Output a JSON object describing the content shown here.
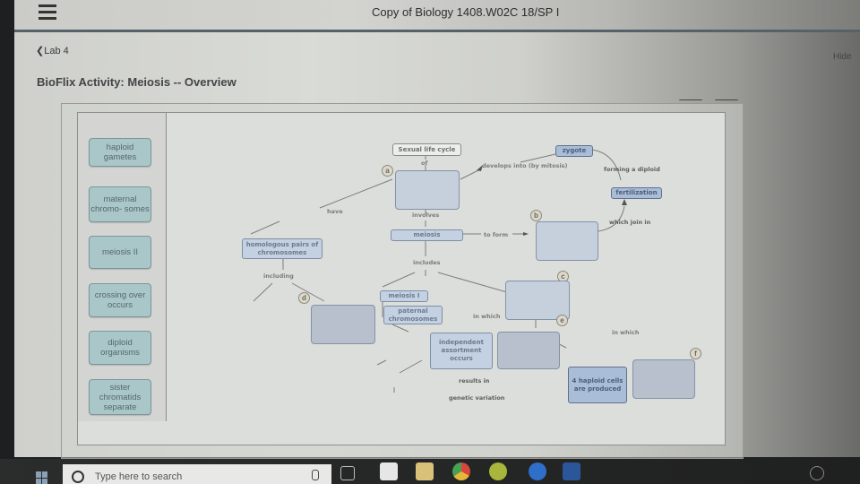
{
  "header": {
    "menu_icon": "hamburger-menu-icon",
    "course_title": "Copy of Biology 1408.W02C 18/SP I"
  },
  "nav": {
    "back_label": "Lab 4",
    "back_icon": "chevron-left-icon",
    "hide_label": "Hide"
  },
  "page": {
    "title": "BioFlix Activity: Meiosis -- Overview"
  },
  "word_bank": [
    "haploid gametes",
    "maternal chromo- somes",
    "meiosis II",
    "crossing over occurs",
    "diploid organisms",
    "sister chromatids separate"
  ],
  "concept_map": {
    "nodes": {
      "sexual_life_cycle": "Sexual life cycle",
      "zygote": "zygote",
      "fertilization": "fertilization",
      "meiosis": "meiosis",
      "homologous_pairs": "homologous pairs of chromosomes",
      "meiosis_1": "meiosis I",
      "paternal_chromosomes": "paternal chromosomes",
      "independent_assortment": "independent assortment occurs",
      "four_haploid_cells": "4 haploid cells are produced",
      "genetic_variation": "genetic variation"
    },
    "links": {
      "of": "of",
      "develops_into": "develops into (by mitosis)",
      "forming_diploid": "forming a diploid",
      "which_join_in": "which join in",
      "have": "have",
      "involves": "involves",
      "to_form": "to form",
      "includes": "includes",
      "including": "including",
      "in_which_1": "in which",
      "in_which_2": "in which",
      "results_in": "results in"
    },
    "targets": [
      "a",
      "b",
      "c",
      "d",
      "e",
      "f"
    ]
  },
  "taskbar": {
    "search_placeholder": "Type here to search",
    "icons": [
      "windows-start-icon",
      "cortana-mic-icon",
      "task-view-icon",
      "store-icon",
      "file-explorer-icon",
      "chrome-icon",
      "webroot-icon",
      "edge-icon",
      "word-icon",
      "people-icon"
    ]
  }
}
